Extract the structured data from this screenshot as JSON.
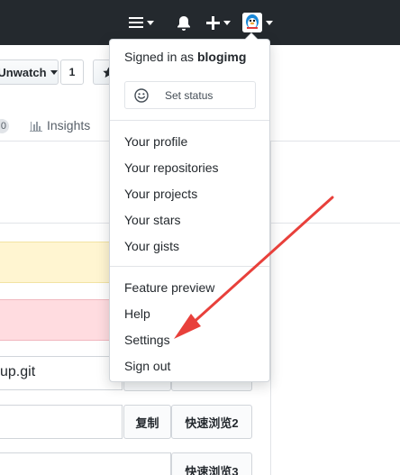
{
  "header": {
    "menu_icon": "hamburger-icon",
    "bell_icon": "bell-icon",
    "plus_icon": "plus-icon",
    "avatar": "avatar-icon"
  },
  "repo": {
    "unwatch_label": "Unwatch",
    "watch_count": "1",
    "star_icon": "star-icon",
    "tab_count_fragment": "0",
    "insights_label": "Insights",
    "clone_url_fragment": "up.git",
    "copy_label": "复制",
    "quick_view_2": "快速浏览2",
    "quick_view_3": "快速浏览3"
  },
  "dropdown": {
    "signed_in_prefix": "Signed in as",
    "username": "blogimg",
    "set_status_label": "Set status",
    "group1": [
      "Your profile",
      "Your repositories",
      "Your projects",
      "Your stars",
      "Your gists"
    ],
    "group2": [
      "Feature preview",
      "Help",
      "Settings",
      "Sign out"
    ]
  },
  "annotation": {
    "arrow_color": "#e8403b"
  }
}
